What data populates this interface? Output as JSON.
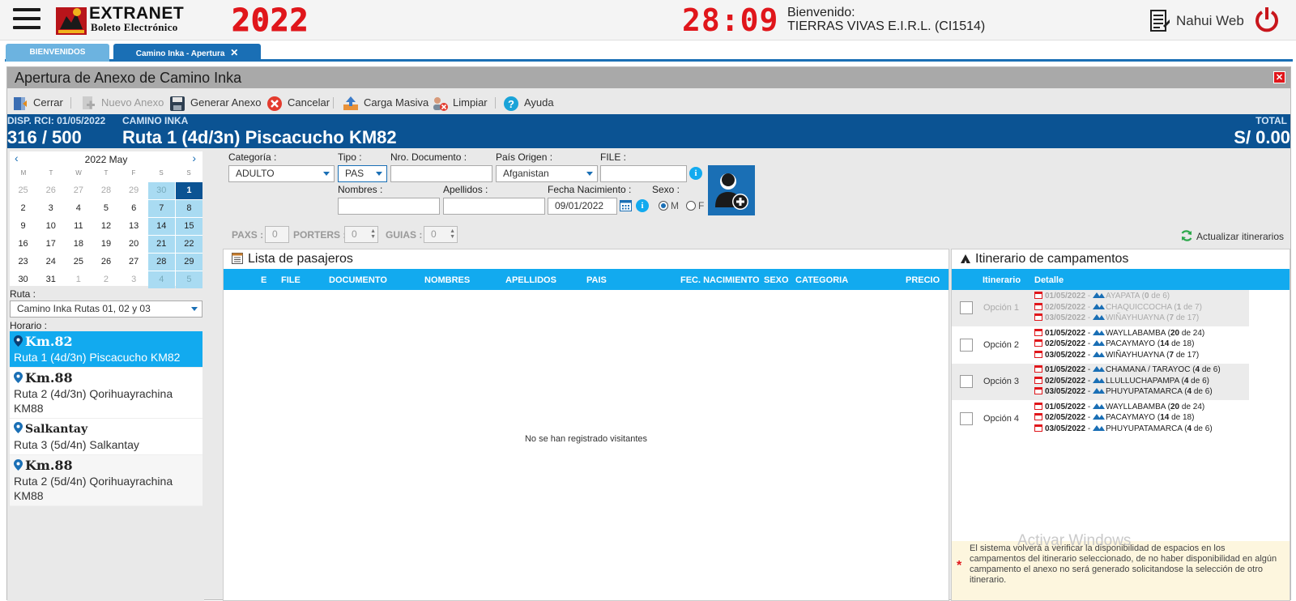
{
  "header": {
    "brand_line1": "EXTRANET",
    "brand_line2": "Boleto Electrónico",
    "year": "2022",
    "clock": "28:09",
    "welcome_label": "Bienvenido:",
    "agency": "TIERRAS VIVAS E.I.R.L. (CI1514)",
    "user_name": "Nahui Web"
  },
  "tabs": [
    {
      "label": "BIENVENIDOS"
    },
    {
      "label": "Camino Inka - Apertura",
      "close": "✕"
    }
  ],
  "panel": {
    "title": "Apertura de Anexo de Camino Inka",
    "close": "✕"
  },
  "toolbar": {
    "close": "Cerrar",
    "new": "Nuevo Anexo",
    "generate": "Generar Anexo",
    "cancel": "Cancelar",
    "bulk": "Carga Masiva",
    "clear": "Limpiar",
    "help": "Ayuda"
  },
  "banner": {
    "disp_label": "DISP. RCI: 01/05/2022",
    "disp_value": "316 / 500",
    "camino_label": "CAMINO INKA",
    "route": "Ruta 1 (4d/3n) Piscacucho KM82",
    "total_label": "TOTAL",
    "total_value": "S/ 0.00"
  },
  "calendar": {
    "month": "2022 May",
    "prev": "‹",
    "next": "›",
    "dow": [
      "M",
      "T",
      "W",
      "T",
      "F",
      "S",
      "S"
    ],
    "days": [
      {
        "d": "25",
        "o": true
      },
      {
        "d": "26",
        "o": true
      },
      {
        "d": "27",
        "o": true
      },
      {
        "d": "28",
        "o": true
      },
      {
        "d": "29",
        "o": true
      },
      {
        "d": "30",
        "o": true,
        "we": true
      },
      {
        "d": "1",
        "sel": true
      },
      {
        "d": "2"
      },
      {
        "d": "3"
      },
      {
        "d": "4"
      },
      {
        "d": "5"
      },
      {
        "d": "6"
      },
      {
        "d": "7",
        "we": true
      },
      {
        "d": "8",
        "we": true
      },
      {
        "d": "9"
      },
      {
        "d": "10"
      },
      {
        "d": "11"
      },
      {
        "d": "12"
      },
      {
        "d": "13"
      },
      {
        "d": "14",
        "we": true
      },
      {
        "d": "15",
        "we": true
      },
      {
        "d": "16"
      },
      {
        "d": "17"
      },
      {
        "d": "18"
      },
      {
        "d": "19"
      },
      {
        "d": "20"
      },
      {
        "d": "21",
        "we": true
      },
      {
        "d": "22",
        "we": true
      },
      {
        "d": "23"
      },
      {
        "d": "24"
      },
      {
        "d": "25"
      },
      {
        "d": "26"
      },
      {
        "d": "27"
      },
      {
        "d": "28",
        "we": true
      },
      {
        "d": "29",
        "we": true
      },
      {
        "d": "30"
      },
      {
        "d": "31"
      },
      {
        "d": "1",
        "o": true
      },
      {
        "d": "2",
        "o": true
      },
      {
        "d": "3",
        "o": true
      },
      {
        "d": "4",
        "o": true,
        "we": true
      },
      {
        "d": "5",
        "o": true,
        "we": true
      }
    ]
  },
  "ruta": {
    "label": "Ruta :",
    "value": "Camino Inka Rutas 01, 02 y 03"
  },
  "horario": {
    "label": "Horario :",
    "items": [
      {
        "title": "Km.82",
        "desc": "Ruta 1 (4d/3n) Piscacucho KM82",
        "active": true
      },
      {
        "title": "Km.88",
        "desc": "Ruta 2 (4d/3n) Qorihuayrachina KM88"
      },
      {
        "title": "Salkantay",
        "desc": "Ruta 3 (5d/4n) Salkantay"
      },
      {
        "title": "Km.88",
        "desc": "Ruta 2 (5d/4n) Qorihuayrachina KM88"
      }
    ]
  },
  "form": {
    "categoria_label": "Categoría :",
    "categoria_value": "ADULTO",
    "tipo_label": "Tipo :",
    "tipo_value": "PAS",
    "doc_label": "Nro. Documento :",
    "doc_value": "",
    "pais_label": "País Origen :",
    "pais_value": "Afganistan",
    "file_label": "FILE :",
    "file_value": "",
    "nombres_label": "Nombres :",
    "nombres_value": "",
    "apellidos_label": "Apellidos :",
    "apellidos_value": "",
    "fecha_label": "Fecha Nacimiento :",
    "fecha_value": "09/01/2022",
    "sexo_label": "Sexo :",
    "sexo_m": "M",
    "sexo_f": "F"
  },
  "counts": {
    "paxs_label": "PAXS :",
    "paxs_value": "0",
    "porters_label": "PORTERS :",
    "porters_value": "0",
    "guias_label": "GUIAS :",
    "guias_value": "0",
    "update_label": "Actualizar itinerarios"
  },
  "passengers": {
    "title": "Lista de pasajeros",
    "columns": [
      "E",
      "FILE",
      "DOCUMENTO",
      "NOMBRES",
      "APELLIDOS",
      "PAIS",
      "FEC. NACIMIENTO",
      "SEXO",
      "CATEGORIA",
      "PRECIO"
    ],
    "empty": "No se han registrado visitantes"
  },
  "itinerary": {
    "title": "Itinerario de campamentos",
    "col_itinerario": "Itinerario",
    "col_detalle": "Detalle",
    "options": [
      {
        "name": "Opción 1",
        "disabled": true,
        "lines": [
          {
            "date": "01/05/2022",
            "camp": "AYAPATA",
            "used": "0",
            "cap": "6"
          },
          {
            "date": "02/05/2022",
            "camp": "CHAQUICCOCHA",
            "used": "1",
            "cap": "7"
          },
          {
            "date": "03/05/2022",
            "camp": "WIÑAYHUAYNA",
            "used": "7",
            "cap": "17"
          }
        ]
      },
      {
        "name": "Opción 2",
        "lines": [
          {
            "date": "01/05/2022",
            "camp": "WAYLLABAMBA",
            "used": "20",
            "cap": "24"
          },
          {
            "date": "02/05/2022",
            "camp": "PACAYMAYO",
            "used": "14",
            "cap": "18"
          },
          {
            "date": "03/05/2022",
            "camp": "WIÑAYHUAYNA",
            "used": "7",
            "cap": "17"
          }
        ]
      },
      {
        "name": "Opción 3",
        "lines": [
          {
            "date": "01/05/2022",
            "camp": "CHAMANA / TARAYOC",
            "used": "4",
            "cap": "6"
          },
          {
            "date": "02/05/2022",
            "camp": "LLULLUCHAPAMPA",
            "used": "4",
            "cap": "6"
          },
          {
            "date": "03/05/2022",
            "camp": "PHUYUPATAMARCA",
            "used": "4",
            "cap": "6"
          }
        ]
      },
      {
        "name": "Opción 4",
        "lines": [
          {
            "date": "01/05/2022",
            "camp": "WAYLLABAMBA",
            "used": "20",
            "cap": "24"
          },
          {
            "date": "02/05/2022",
            "camp": "PACAYMAYO",
            "used": "14",
            "cap": "18"
          },
          {
            "date": "03/05/2022",
            "camp": "PHUYUPATAMARCA",
            "used": "4",
            "cap": "6"
          }
        ]
      }
    ],
    "note": "El sistema volverá a verificar la disponibilidad de espacios en los campamentos del itinerario seleccionado, de no haber disponibilidad en algún campamento el anexo no será generado solicitandose la selección de otro itinerario."
  },
  "watermark": "Activar Windows",
  "colors": {
    "accent": "#12aaef",
    "brand_blue": "#0b5393",
    "red": "#e0161b"
  }
}
